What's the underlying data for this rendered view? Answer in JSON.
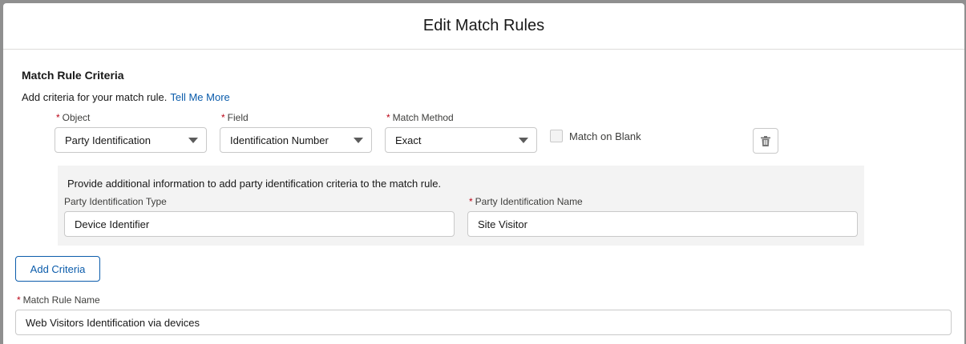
{
  "modal": {
    "title": "Edit Match Rules"
  },
  "criteria": {
    "section_title": "Match Rule Criteria",
    "intro_text": "Add criteria for your match rule.",
    "intro_link": "Tell Me More",
    "object": {
      "label": "Object",
      "value": "Party Identification"
    },
    "field": {
      "label": "Field",
      "value": "Identification Number"
    },
    "match_method": {
      "label": "Match Method",
      "value": "Exact"
    },
    "match_on_blank": {
      "label": "Match on Blank",
      "checked": false
    },
    "delete_icon": "trash-icon",
    "required_mark": "*"
  },
  "party_panel": {
    "info": "Provide additional information to add party identification criteria to the match rule.",
    "type": {
      "label": "Party Identification Type",
      "value": "Device Identifier"
    },
    "name": {
      "label": "Party Identification Name",
      "value": "Site Visitor"
    }
  },
  "add_criteria_label": "Add Criteria",
  "rule_name": {
    "label": "Match Rule Name",
    "value": "Web Visitors Identification via devices"
  },
  "colors": {
    "brand": "#0b5cab",
    "required": "#ba0517",
    "panel_bg": "#f3f3f3",
    "border": "#c9c9c9"
  }
}
